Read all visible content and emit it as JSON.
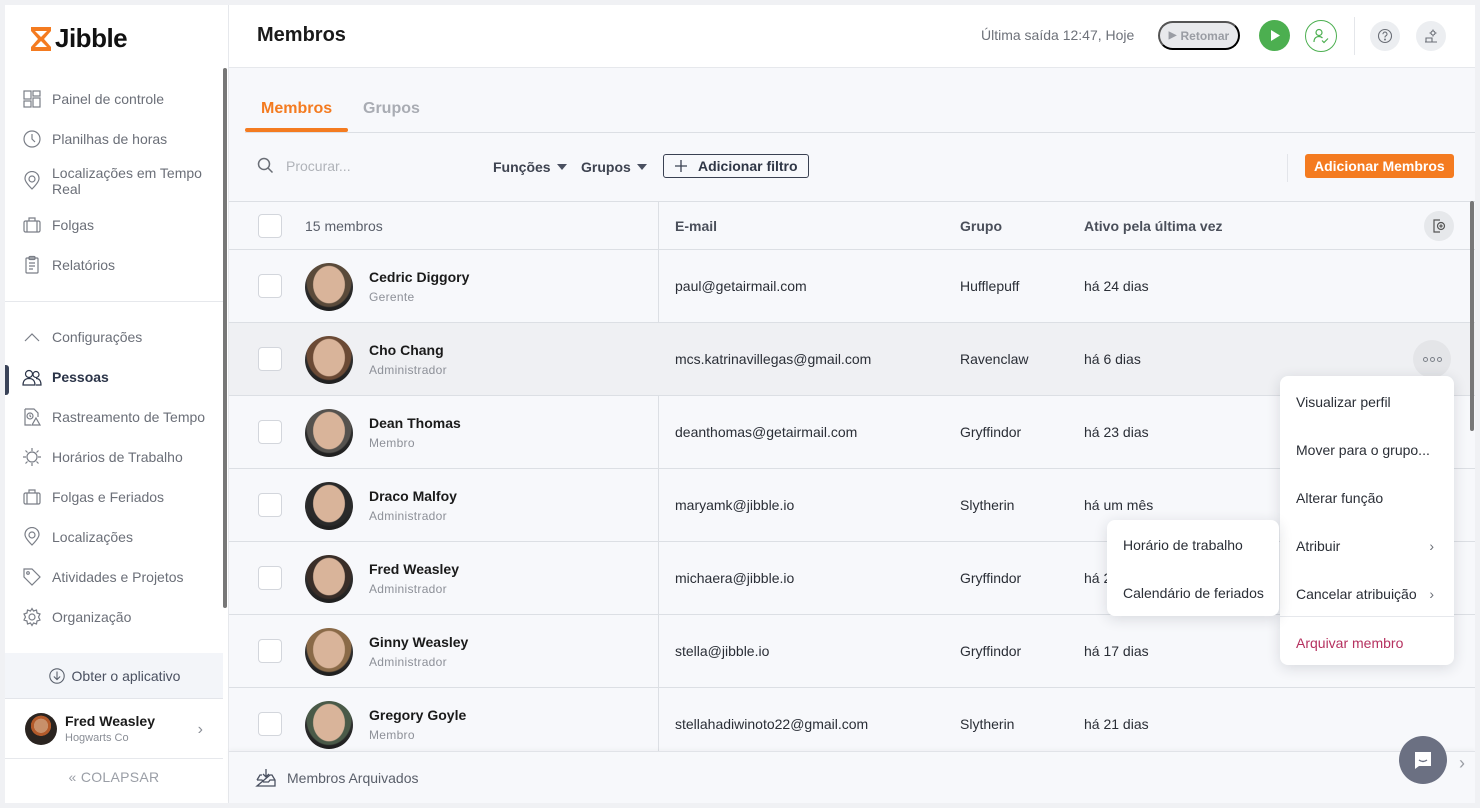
{
  "app": {
    "logo_text": "Jibble",
    "brand_color": "#f47b20",
    "success_color": "#4caf50",
    "danger_color": "#b5315f"
  },
  "sidebar": {
    "items": [
      {
        "label": "Painel de controle",
        "icon": "dashboard-icon"
      },
      {
        "label": "Planilhas de horas",
        "icon": "clock-icon"
      },
      {
        "label": "Localizações em Tempo Real",
        "icon": "location-pin-icon"
      },
      {
        "label": "Folgas",
        "icon": "briefcase-icon"
      },
      {
        "label": "Relatórios",
        "icon": "clipboard-icon"
      }
    ],
    "settings_label": "Configurações",
    "settings_items": [
      {
        "label": "Pessoas",
        "icon": "people-icon",
        "active": true
      },
      {
        "label": "Rastreamento de Tempo",
        "icon": "time-tracking-icon"
      },
      {
        "label": "Horários de Trabalho",
        "icon": "work-schedule-icon"
      },
      {
        "label": "Folgas e Feriados",
        "icon": "briefcase-icon"
      },
      {
        "label": "Localizações",
        "icon": "location-pin-icon"
      },
      {
        "label": "Atividades e Projetos",
        "icon": "tag-icon"
      },
      {
        "label": "Organização",
        "icon": "gear-icon"
      }
    ],
    "get_app_label": "Obter o aplicativo",
    "user": {
      "name": "Fred Weasley",
      "org": "Hogwarts Co"
    },
    "collapse_label": "COLAPSAR"
  },
  "header": {
    "title": "Membros",
    "last_out": "Última saída 12:47, Hoje",
    "resume_label": "Retomar"
  },
  "tabs": [
    {
      "label": "Membros",
      "active": true
    },
    {
      "label": "Grupos",
      "active": false
    }
  ],
  "toolbar": {
    "search_placeholder": "Procurar...",
    "filters": [
      "Funções",
      "Grupos"
    ],
    "add_filter_label": "Adicionar filtro",
    "add_members_label": "Adicionar Membros"
  },
  "table": {
    "count_label": "15 membros",
    "columns": [
      "E-mail",
      "Grupo",
      "Ativo pela última vez"
    ],
    "rows": [
      {
        "name": "Cedric Diggory",
        "role": "Gerente",
        "email": "paul@getairmail.com",
        "group": "Hufflepuff",
        "last_active": "há 24 dias",
        "avatar_color": "#5a4a3a"
      },
      {
        "name": "Cho Chang",
        "role": "Administrador",
        "email": "mcs.katrinavillegas@gmail.com",
        "group": "Ravenclaw",
        "last_active": "há 6 dias",
        "avatar_color": "#6b4a35"
      },
      {
        "name": "Dean Thomas",
        "role": "Membro",
        "email": "deanthomas@getairmail.com",
        "group": "Gryffindor",
        "last_active": "há 23 dias",
        "avatar_color": "#55524e"
      },
      {
        "name": "Draco Malfoy",
        "role": "Administrador",
        "email": "maryamk@jibble.io",
        "group": "Slytherin",
        "last_active": "há um mês",
        "avatar_color": "#2a2a2a"
      },
      {
        "name": "Fred Weasley",
        "role": "Administrador",
        "email": "michaera@jibble.io",
        "group": "Gryffindor",
        "last_active": "há 2",
        "avatar_color": "#3a2e28"
      },
      {
        "name": "Ginny Weasley",
        "role": "Administrador",
        "email": "stella@jibble.io",
        "group": "Gryffindor",
        "last_active": "há 17 dias",
        "avatar_color": "#8a6a48"
      },
      {
        "name": "Gregory Goyle",
        "role": "Membro",
        "email": "stellahadiwinoto22@gmail.com",
        "group": "Slytherin",
        "last_active": "há 21 dias",
        "avatar_color": "#4a5a48"
      }
    ]
  },
  "row_menu": {
    "items": [
      {
        "label": "Visualizar perfil"
      },
      {
        "label": "Mover para o grupo..."
      },
      {
        "label": "Alterar função"
      },
      {
        "label": "Atribuir",
        "submenu": true
      },
      {
        "label": "Cancelar atribuição",
        "submenu": true
      },
      {
        "label": "Arquivar membro",
        "danger": true
      }
    ]
  },
  "sub_menu": {
    "items": [
      {
        "label": "Horário de trabalho"
      },
      {
        "label": "Calendário de feriados"
      }
    ]
  },
  "footer": {
    "archived_label": "Membros Arquivados"
  }
}
